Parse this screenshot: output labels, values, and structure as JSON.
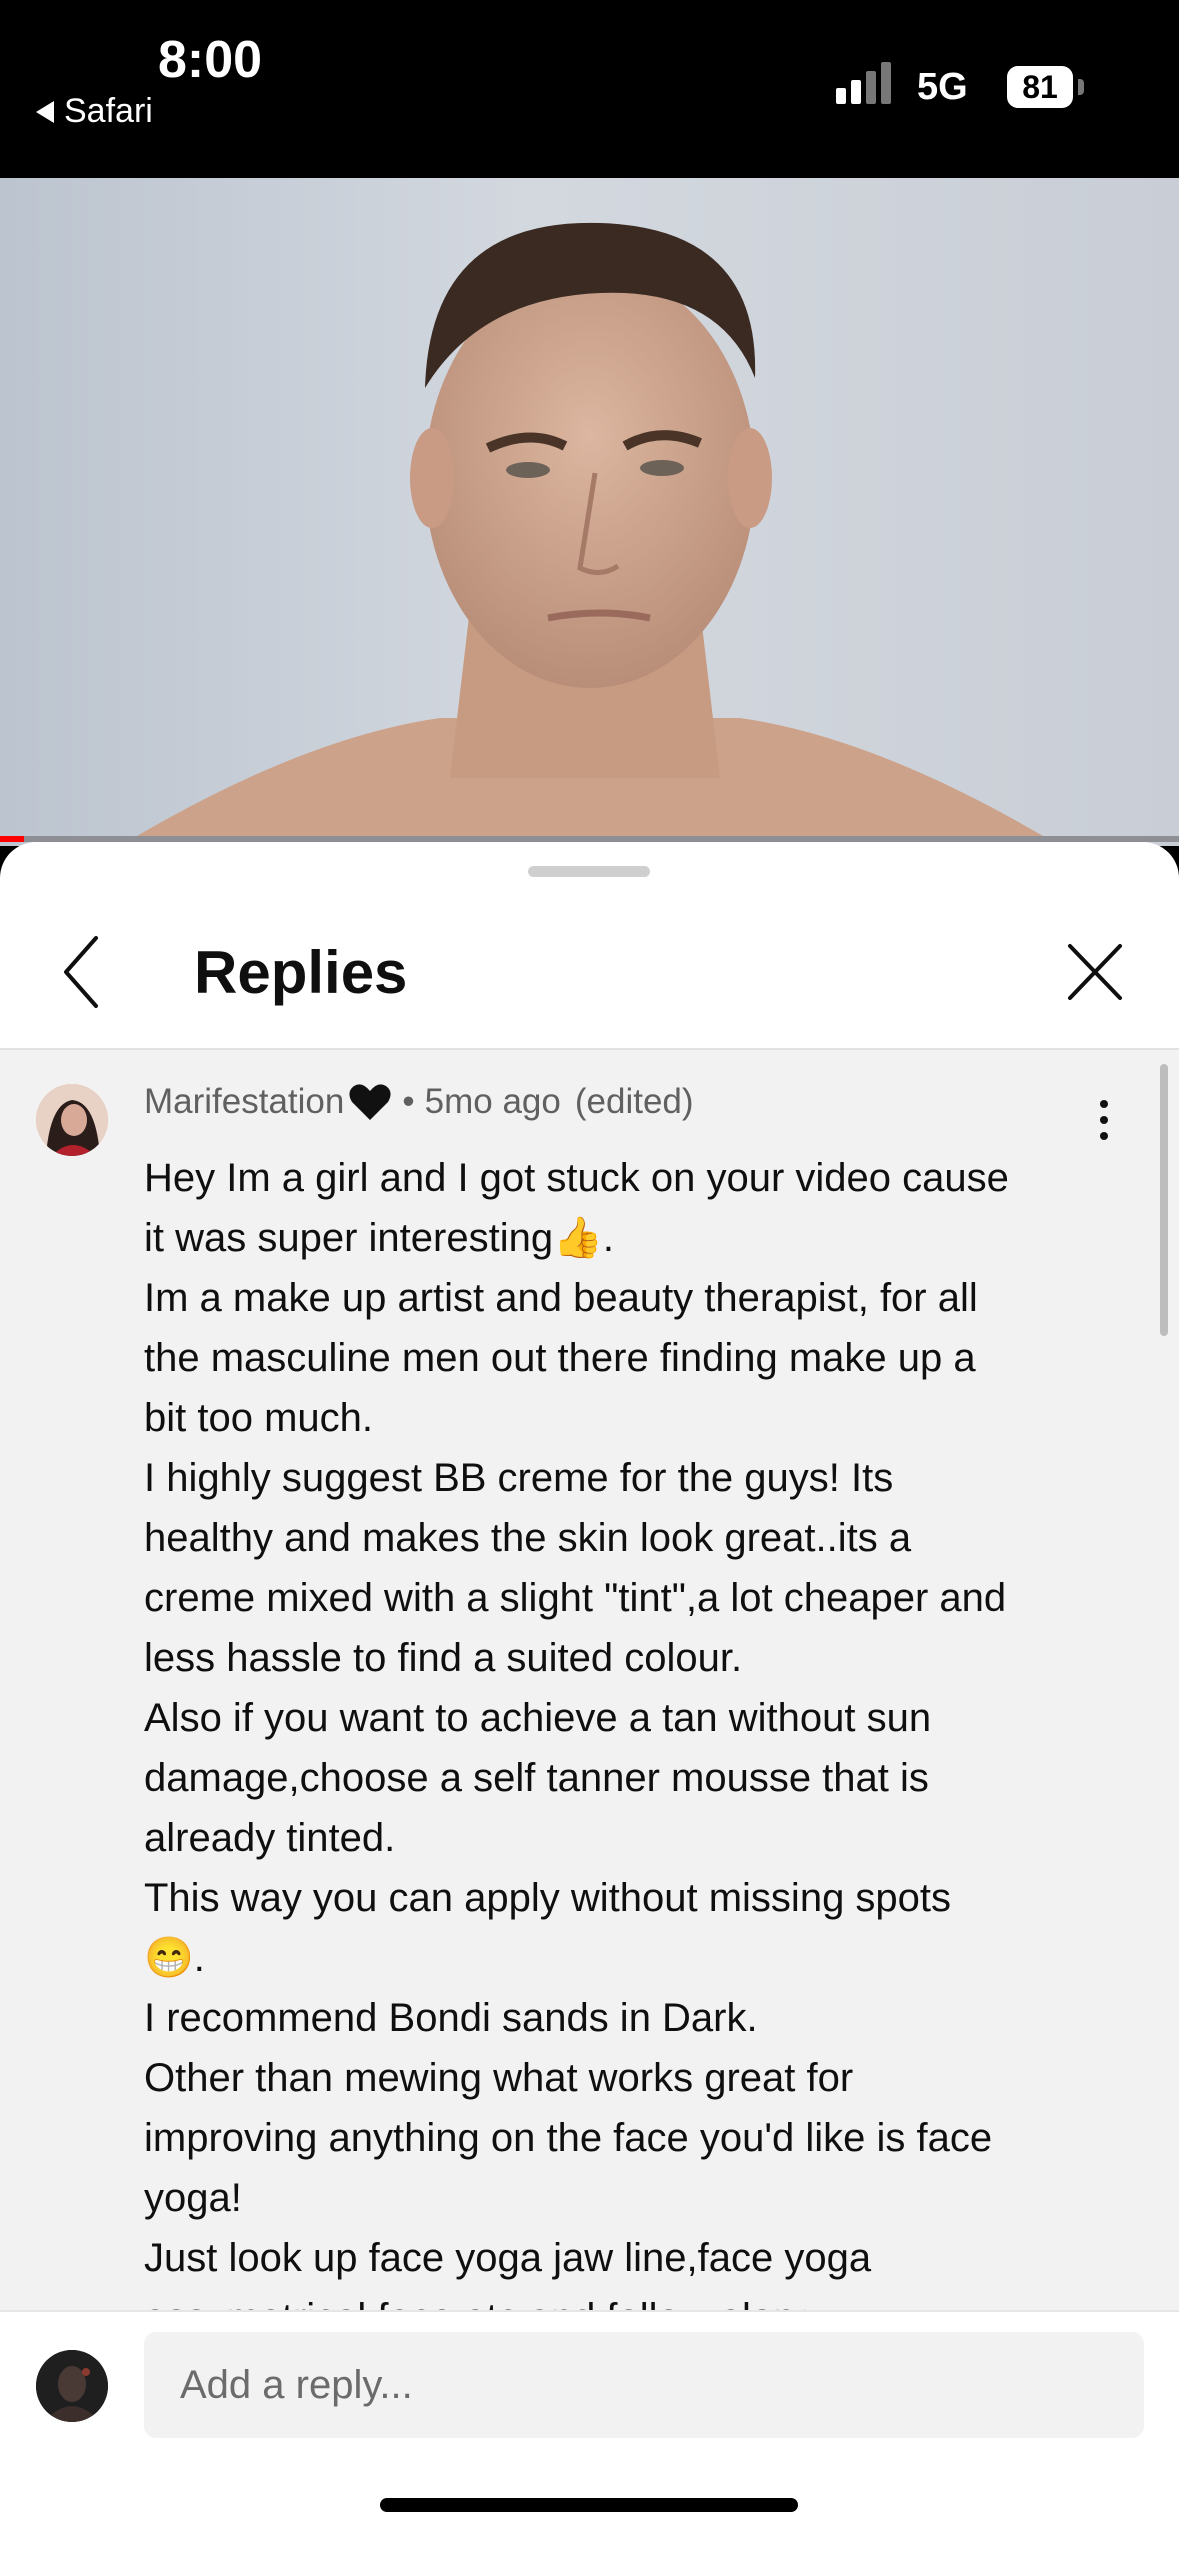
{
  "status_bar": {
    "time": "8:00",
    "back_app": "Safari",
    "network": "5G",
    "battery": "81"
  },
  "video": {
    "progress": 0.02,
    "progress_color": "#ff0000"
  },
  "panel": {
    "title": "Replies",
    "back_icon": "chevron-left-icon",
    "close_icon": "close-icon"
  },
  "comment": {
    "author": "Marifestation",
    "author_badge_icon": "black-heart-icon",
    "separator": "•",
    "time": "5mo ago",
    "edited": "(edited)",
    "lines": [
      "Hey Im a girl and I got stuck on your video cause",
      "it was super interesting👍.",
      "Im a make up artist and beauty therapist, for all",
      "the masculine men out there finding make up a",
      "bit too much.",
      "I highly suggest BB creme for the guys! Its",
      "healthy and makes the skin look great..its a",
      "creme mixed with a slight \"tint\",a lot cheaper and",
      "less hassle to find a suited colour.",
      "Also if you want to achieve a tan without sun",
      "damage,choose a self tanner mousse that is",
      "already tinted.",
      "This way you can apply without missing spots",
      "😁.",
      "I recommend Bondi sands in Dark.",
      "Other than mewing what works great for",
      "improving anything on the face you'd like is face",
      "yoga!",
      "Just look up face yoga jaw line,face yoga",
      "assymetrical face etc and follow along"
    ]
  },
  "reply_bar": {
    "placeholder": "Add a reply..."
  }
}
